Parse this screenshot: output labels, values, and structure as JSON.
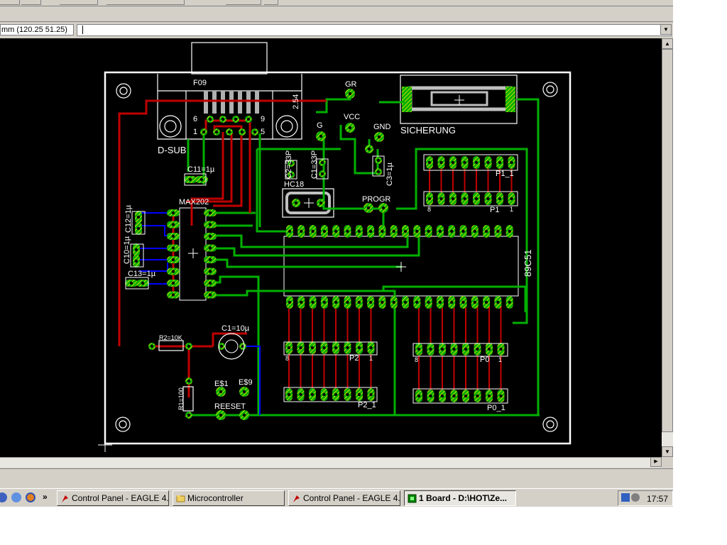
{
  "statusbar": {
    "coordinates": "mm (120.25 51.25)",
    "command_text": ""
  },
  "board": {
    "labels": {
      "f09": "F09",
      "dsub": "D-SUB",
      "gr": "GR",
      "vcc": "VCC",
      "gnd": "GND",
      "g": "G",
      "sicherung": "SICHERUNG",
      "c11": "C11=1µ",
      "max202": "MAX202",
      "c12": "C12=1µ",
      "c10": "C10=1µ",
      "c13": "C13=1µ",
      "c2": "C2=33P",
      "c1_33p": "C1=33P",
      "hc18": "HC18",
      "c3": "C3=1µ",
      "progr": "PROGR",
      "p1_1": "P1_1",
      "p1": "P1",
      "chip": "89C51",
      "r2": "R2=10K",
      "c1": "C1=10µ",
      "r1": "R1=100",
      "e1": "E$1",
      "e9": "E$9",
      "reset": "REESET",
      "p2": "P2",
      "p2_1": "P2_1",
      "p0": "P0",
      "p0_1": "P0_1",
      "pin1": "1",
      "pin5": "5",
      "pin6": "6",
      "pin9": "9",
      "pin8": "8",
      "dim254": "2.54"
    },
    "colors": {
      "background": "#000000",
      "outline": "#ffffff",
      "top_layer": "#c00000",
      "bottom_layer": "#00b000",
      "blue_wire": "#0000ff",
      "pad": "#00b000",
      "pad_hatch": "#ffe000"
    }
  },
  "taskbar": {
    "overflow": "»",
    "items": [
      {
        "label": "Control Panel - EAGLE 4.1...",
        "icon": "eagle-icon",
        "active": false
      },
      {
        "label": "Microcontroller",
        "icon": "folder-icon",
        "active": false
      },
      {
        "label": "Control Panel - EAGLE 4.1...",
        "icon": "eagle-icon",
        "active": false
      },
      {
        "label": "1 Board - D:\\HOT\\Ze...",
        "icon": "board-icon",
        "active": true
      }
    ],
    "clock": "17:57"
  }
}
